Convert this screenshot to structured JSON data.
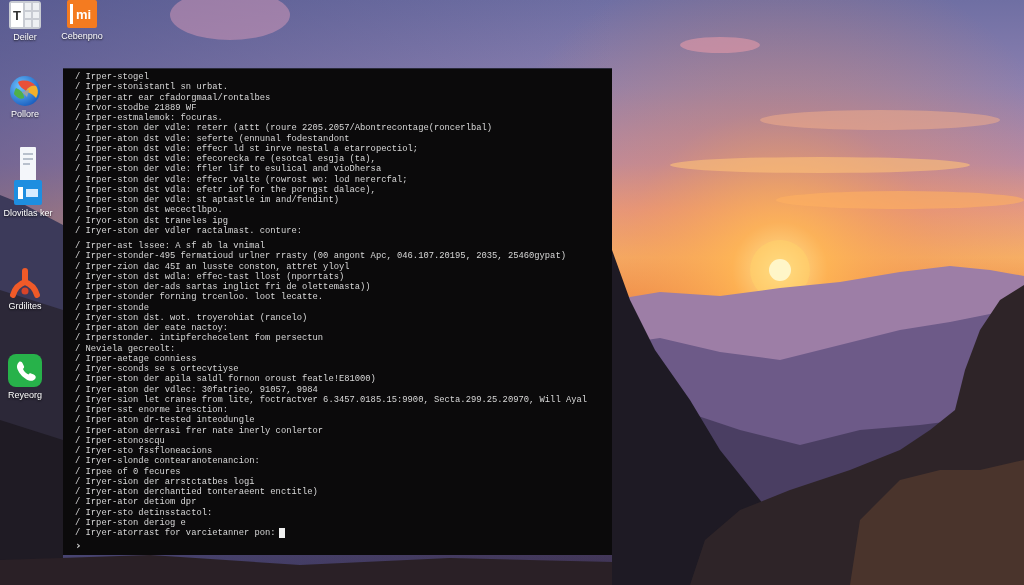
{
  "desktop": {
    "shortcuts": [
      {
        "label": "Deiler",
        "glyph": "T"
      },
      {
        "label": "Cebenpno",
        "glyph": "mi"
      },
      {
        "label": "Pollore"
      },
      {
        "label": "Dlovitlas ker"
      },
      {
        "label": "Grdilites"
      },
      {
        "label": "Reyeorg"
      }
    ]
  },
  "terminal": {
    "blocks": [
      {
        "lines": [
          "/ Irper-stogel",
          "/ Irper-stonistantl sn urbat.",
          "/ Irper-atr ear cfadorgmaal/rontalbes",
          "/ Irvor-stodbe 21889 WF",
          "/ Irper-estmalemok: focuras.",
          "/ Irper-ston der vdle: reterr (attt (roure 2205.2057/Abontrecontage(roncerlbal)",
          "/ Irper-aton dst vdle: seferte (ennunal fodestandont",
          "/ Irper-aton dst vdle: effecr ld st inrve nestal a etarropectiol;",
          "/ Irper-ston dst vdle: efecorecka re (esotcal esgja (ta),",
          "/ Irper-ston der vdle: ffler lif to esulical and vioDhersa",
          "/ Irper-ston der vdle: effecr valte (rowrost wo: lod nerercfal;",
          "/ Irper-ston dst vdla: efetr iof for the porngst dalace),",
          "/ Irper-ston der vdle: st aptastle im and/fendint)",
          "/ Irper-ston dst wecectlbpo.",
          "/ Iryor-ston dst traneles ipg",
          "/ Iryer-ston der vdler ractalmast. conture:"
        ]
      },
      {
        "lines": [
          "/ Irper-ast lssee: A sf ab la vnimal",
          "/ Irper-stonder-495 fermatioud urlner rrasty (00 angont Apc, 046.107.20195, 2035, 25460gypat)",
          "/ Irper-zion dac 45I an lusste conston, attret yloyl",
          "/ Iryer-ston dst wdla: effec-tast llost (nporrtats)",
          "/ Irper-ston der-ads sartas inglict fri de olettemasta))",
          "/ Irper-stonder forning trcenloo. loot lecatte.",
          "/ Irper-stonde",
          "/ Iryer-ston dst. wot. troyerohiat (rancelo)",
          "/ Irper-aton der eate nactoy:",
          "/ Irperstonder. intipferchecelent fom persectun",
          "/ Neviela gecreolt:",
          "/ Irper-aetage conniess",
          "/ Iryer-sconds se s ortecvtiyse",
          "/ Irper-ston der apila saldl fornon oroust featle!E81000)",
          "/ Iryer-aton der vdlec: 30fatrieo, 91057, 9984",
          "/ Iryer-sion let cranse from lite, foctractver 6.3457.0185.15:9900, Secta.299.25.20970, Will Ayal",
          "/ Irper-sst enorme iresction:",
          "/ Irper-aton dr-tested inteodungle",
          "/ Irper-aton derrasi frer nate inerly conlertor",
          "/ Irper-stonoscqu",
          "/ Iryer-sto fssfloneacions",
          "/ Iryer-slonde contearanotenancion:",
          "/ Irpee of 0 fecures",
          "/ Iryer-sion der arrstctatbes logi",
          "/ Iryer-aton derchantied tonteraeent enctitle)",
          "/ Irper-ator detiom dpr",
          "/ Iryer-sto detinsstactol:",
          "/ Irper-ston deriog e",
          "/ Iryer-atorrast for varcietanner pon:"
        ]
      }
    ],
    "cursor": true,
    "prompt": "›"
  }
}
